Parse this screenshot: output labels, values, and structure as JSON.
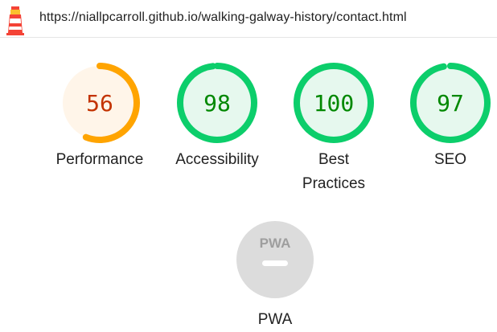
{
  "header": {
    "url": "https://niallpcarroll.github.io/walking-galway-history/contact.html",
    "logo_icon": "lighthouse-icon"
  },
  "gauges": [
    {
      "key": "performance",
      "score": "56",
      "label": "Performance",
      "value": 0.56,
      "color": "#ffa400",
      "fill": "#fff5e9",
      "text_color": "#c33300"
    },
    {
      "key": "accessibility",
      "score": "98",
      "label": "Accessibility",
      "value": 0.98,
      "color": "#0cce6b",
      "fill": "#e6f8ee",
      "text_color": "#008800"
    },
    {
      "key": "best-practices",
      "score": "100",
      "label": "Best Practices",
      "value": 1.0,
      "color": "#0cce6b",
      "fill": "#e6f8ee",
      "text_color": "#008800"
    },
    {
      "key": "seo",
      "score": "97",
      "label": "SEO",
      "value": 0.97,
      "color": "#0cce6b",
      "fill": "#e6f8ee",
      "text_color": "#008800"
    }
  ],
  "pwa": {
    "badge_text": "PWA",
    "label": "PWA",
    "fill": "#dcdcdc",
    "text_color": "#9e9e9e"
  }
}
